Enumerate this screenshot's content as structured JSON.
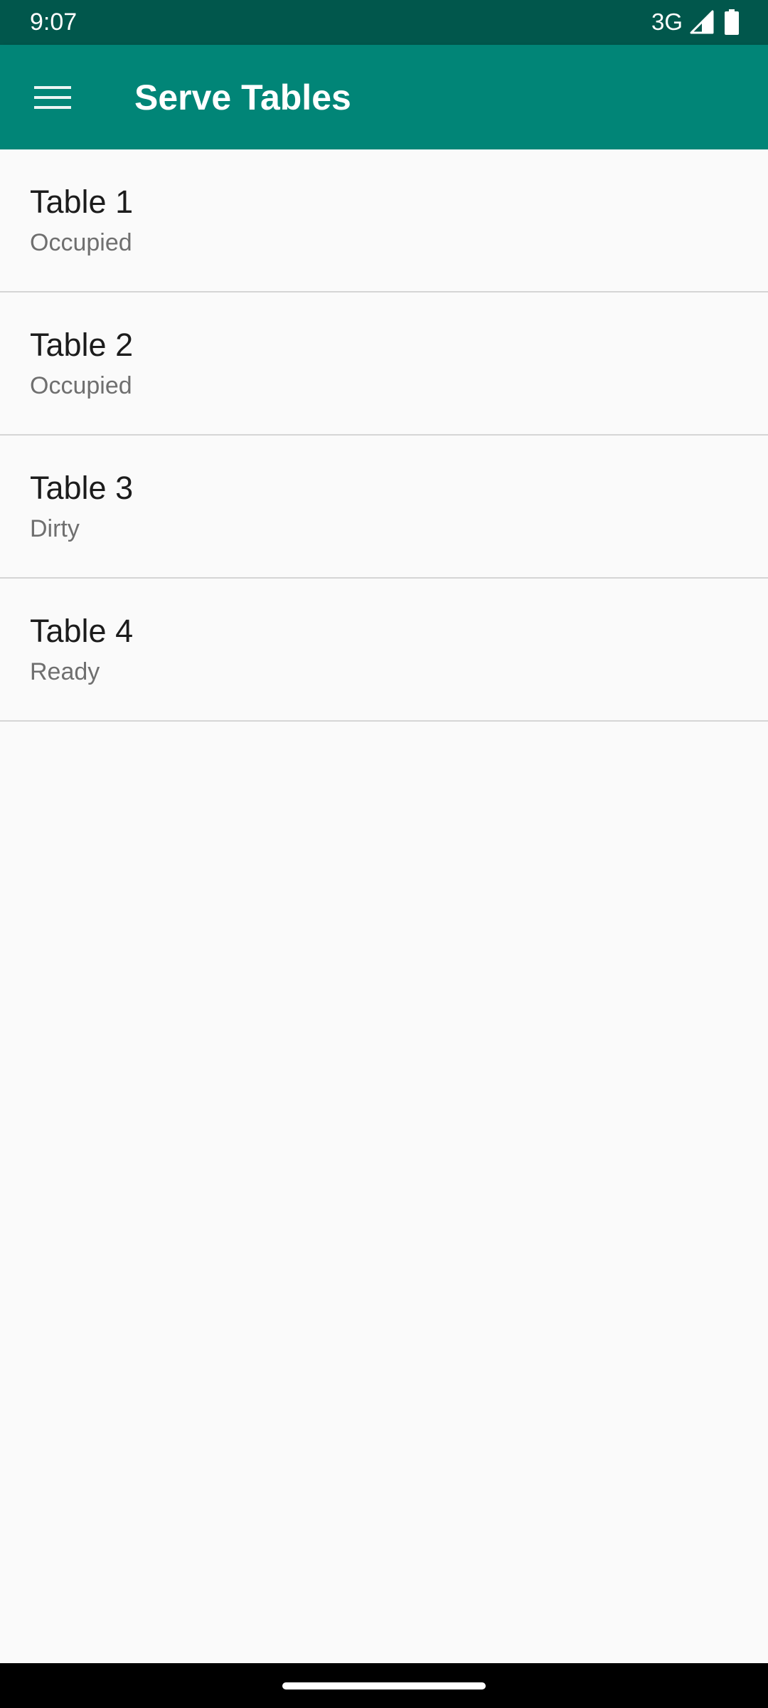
{
  "status_bar": {
    "time": "9:07",
    "network": "3G",
    "signal_icon": "cell-signal-icon",
    "battery_icon": "battery-full-icon"
  },
  "app_bar": {
    "menu_icon": "hamburger-menu-icon",
    "title": "Serve Tables"
  },
  "tables": [
    {
      "name": "Table 1",
      "status": "Occupied"
    },
    {
      "name": "Table 2",
      "status": "Occupied"
    },
    {
      "name": "Table 3",
      "status": "Dirty"
    },
    {
      "name": "Table 4",
      "status": "Ready"
    }
  ],
  "colors": {
    "status_bar": "#01574c",
    "app_bar": "#018577",
    "background": "#fafafa",
    "divider": "#d5d5d5",
    "primary_text": "#1c1c1c",
    "secondary_text": "#6f6f6f"
  }
}
